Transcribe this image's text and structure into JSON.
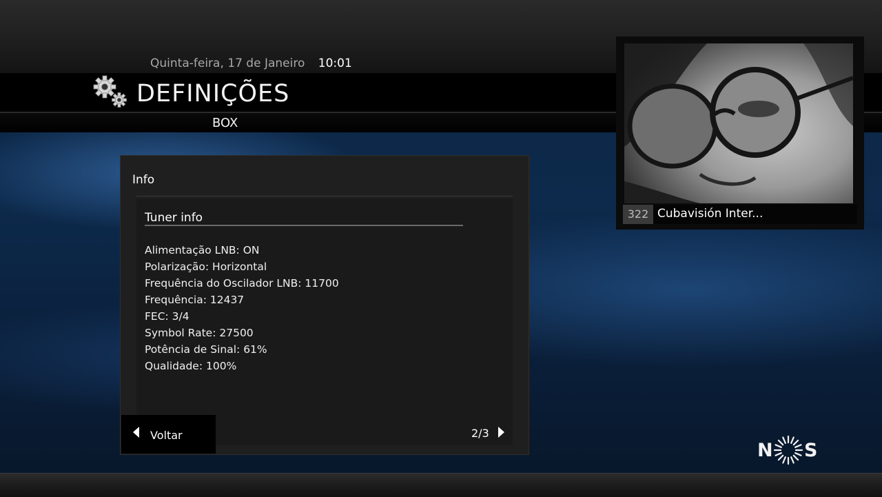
{
  "header": {
    "date": "Quinta-feira, 17 de Janeiro",
    "time": "10:01",
    "title": "DEFINIÇÕES",
    "subtitle": "BOX",
    "settings_icon": "gears-icon"
  },
  "preview": {
    "channel_number": "322",
    "channel_name": "Cubavisión Inter..."
  },
  "panel": {
    "title": "Info",
    "section_title": "Tuner info",
    "items": [
      "Alimentação LNB: ON",
      "Polarização: Horizontal",
      "Frequência do Oscilador LNB: 11700",
      "Frequência: 12437",
      "FEC: 3/4",
      "Symbol Rate: 27500",
      "Potência de Sinal: 61%",
      "Qualidade: 100%"
    ],
    "back_label": "Voltar",
    "pager": "2/3"
  },
  "brand": {
    "logo_text_left": "N",
    "logo_text_right": "S",
    "logo_icon": "sunburst-icon"
  },
  "colors": {
    "background_blue": "#0d2a4c",
    "panel": "#1f1f1f",
    "text": "#f0f0f0"
  }
}
